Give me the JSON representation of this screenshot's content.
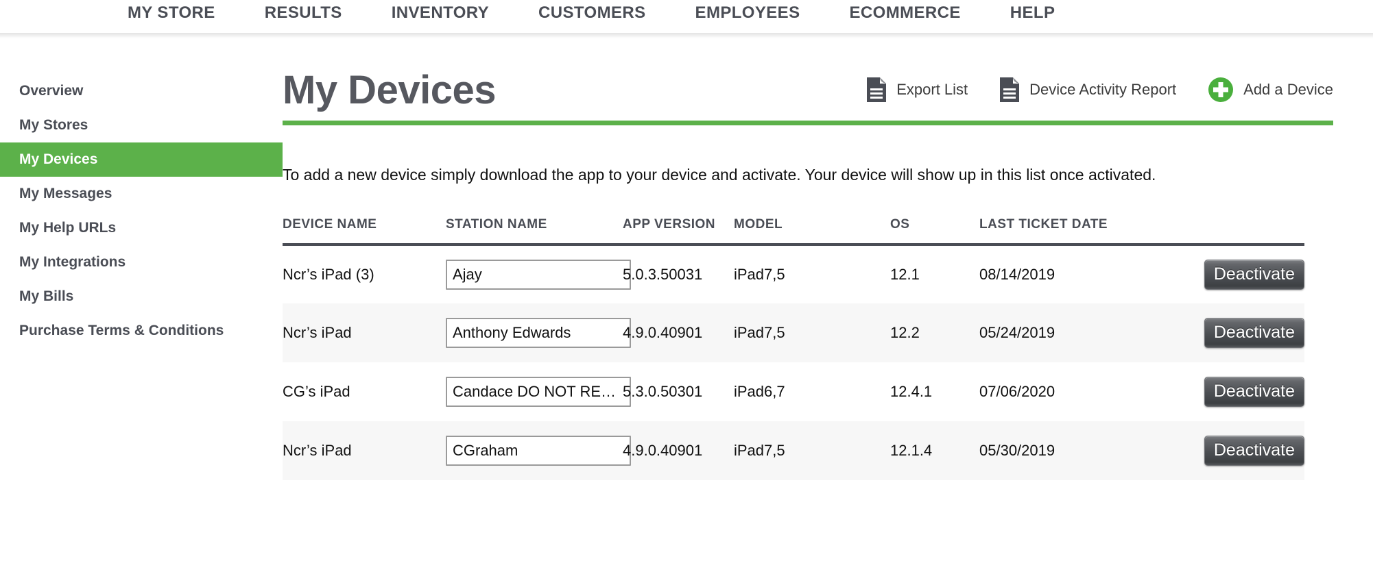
{
  "topnav": {
    "items": [
      {
        "label": "MY STORE"
      },
      {
        "label": "RESULTS"
      },
      {
        "label": "INVENTORY"
      },
      {
        "label": "CUSTOMERS"
      },
      {
        "label": "EMPLOYEES"
      },
      {
        "label": "ECOMMERCE"
      },
      {
        "label": "HELP"
      }
    ]
  },
  "sidebar": {
    "items": [
      {
        "label": "Overview",
        "active": false
      },
      {
        "label": "My Stores",
        "active": false
      },
      {
        "label": "My Devices",
        "active": true
      },
      {
        "label": "My Messages",
        "active": false
      },
      {
        "label": "My Help URLs",
        "active": false
      },
      {
        "label": "My Integrations",
        "active": false
      },
      {
        "label": "My Bills",
        "active": false
      },
      {
        "label": "Purchase Terms & Conditions",
        "active": false
      }
    ],
    "active_label": "My Devices"
  },
  "main": {
    "title": "My Devices",
    "intro": "To add a new device simply download the app to your device and activate. Your device will show up in this list once activated.",
    "actions": [
      {
        "label": "Export List",
        "icon": "document-icon"
      },
      {
        "label": "Device Activity Report",
        "icon": "document-icon"
      },
      {
        "label": "Add a Device",
        "icon": "plus-circle-icon"
      }
    ]
  },
  "table": {
    "columns": [
      "DEVICE NAME",
      "STATION NAME",
      "APP VERSION",
      "MODEL",
      "OS",
      "LAST TICKET DATE",
      ""
    ],
    "rows": [
      {
        "device_name": "Ncr’s iPad (3)",
        "station_name": "Ajay",
        "app_version": "5.0.3.50031",
        "model": "iPad7,5",
        "os": "12.1",
        "last_ticket_date": "08/14/2019",
        "action_label": "Deactivate"
      },
      {
        "device_name": "Ncr’s iPad",
        "station_name": "Anthony Edwards",
        "app_version": "4.9.0.40901",
        "model": "iPad7,5",
        "os": "12.2",
        "last_ticket_date": "05/24/2019",
        "action_label": "Deactivate"
      },
      {
        "device_name": "CG’s iPad",
        "station_name": "Candace DO NOT REMOVE",
        "app_version": "5.3.0.50301",
        "model": "iPad6,7",
        "os": "12.4.1",
        "last_ticket_date": "07/06/2020",
        "action_label": "Deactivate"
      },
      {
        "device_name": "Ncr’s iPad",
        "station_name": "CGraham",
        "app_version": "4.9.0.40901",
        "model": "iPad7,5",
        "os": "12.1.4",
        "last_ticket_date": "05/30/2019",
        "action_label": "Deactivate"
      }
    ]
  },
  "colors": {
    "accent_green": "#5cb14a",
    "text_dark": "#4a4d55",
    "row_alt": "#f7f7f7",
    "button_dark": "#4d5054"
  }
}
